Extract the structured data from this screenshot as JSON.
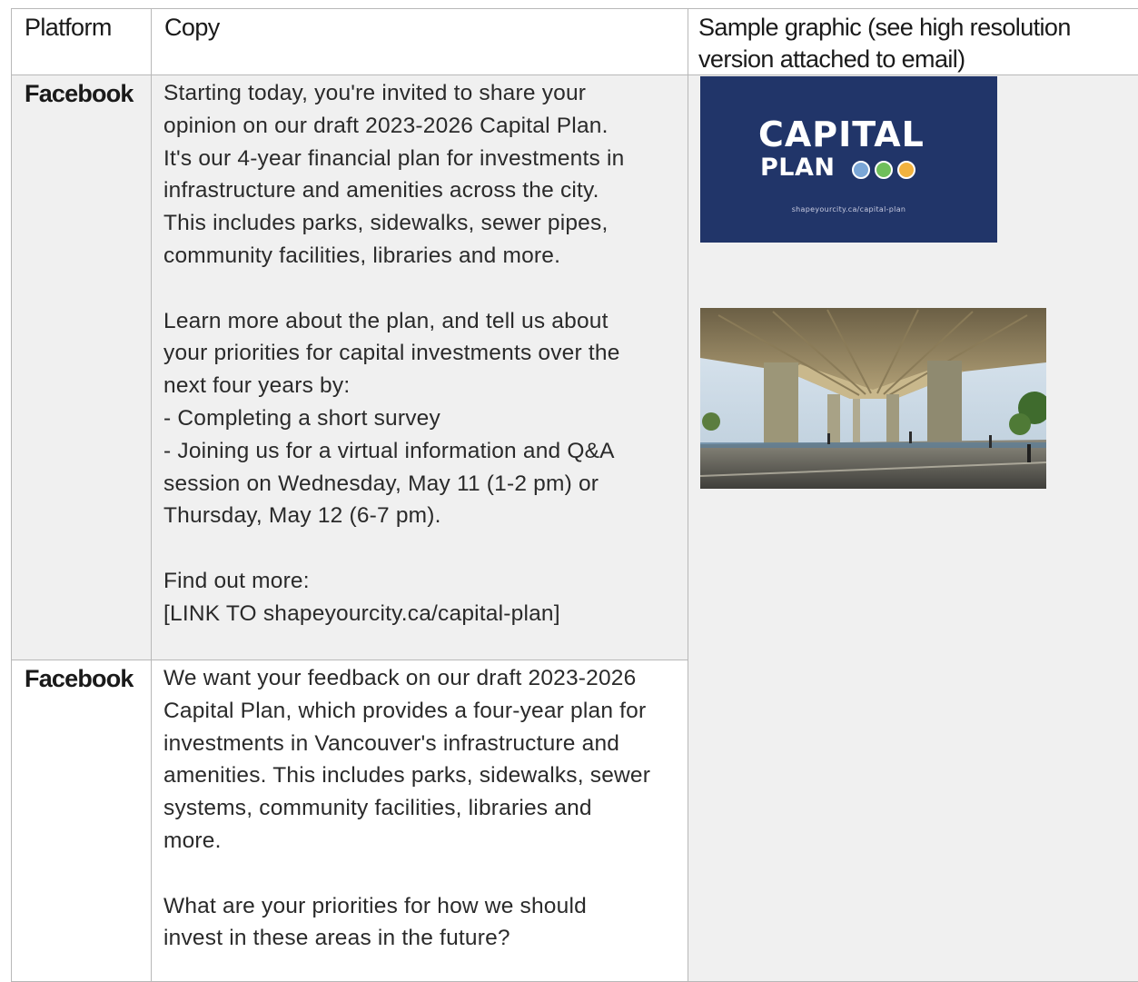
{
  "table": {
    "headers": {
      "platform": "Platform",
      "copy": "Copy",
      "graphic_line1": "Sample graphic (see high resolution",
      "graphic_line2": "version attached to email)"
    },
    "rows": [
      {
        "platform": "Facebook",
        "copy": [
          "Starting today, you're invited to share your",
          "opinion on our draft 2023-2026 Capital Plan.",
          "It's our 4-year financial plan for investments in",
          "infrastructure and amenities across the city.",
          "This includes parks, sidewalks, sewer pipes,",
          "community facilities, libraries and more.",
          "",
          "Learn more about the plan, and tell us about",
          "your priorities for capital investments over the",
          "next four years by:",
          "- Completing a short survey",
          "- Joining us for a virtual information and Q&A",
          "session on Wednesday, May 11 (1-2 pm) or",
          "Thursday, May 12 (6-7 pm).",
          "",
          "Find out more:",
          "[LINK TO shapeyourcity.ca/capital-plan]"
        ]
      },
      {
        "platform": "Facebook",
        "copy": [
          "We want your feedback on our draft 2023-2026",
          "Capital Plan, which provides a four-year plan for",
          "investments in Vancouver's infrastructure and",
          "amenities. This includes parks, sidewalks, sewer",
          "systems, community facilities, libraries and",
          "more.",
          "",
          "What are your priorities for how we should",
          "invest in these areas in the future?"
        ]
      }
    ]
  },
  "graphic": {
    "title": "CAPITAL",
    "subtitle": "PLAN",
    "url": "shapeyourcity.ca/capital-plan",
    "bg_color": "#213569"
  }
}
